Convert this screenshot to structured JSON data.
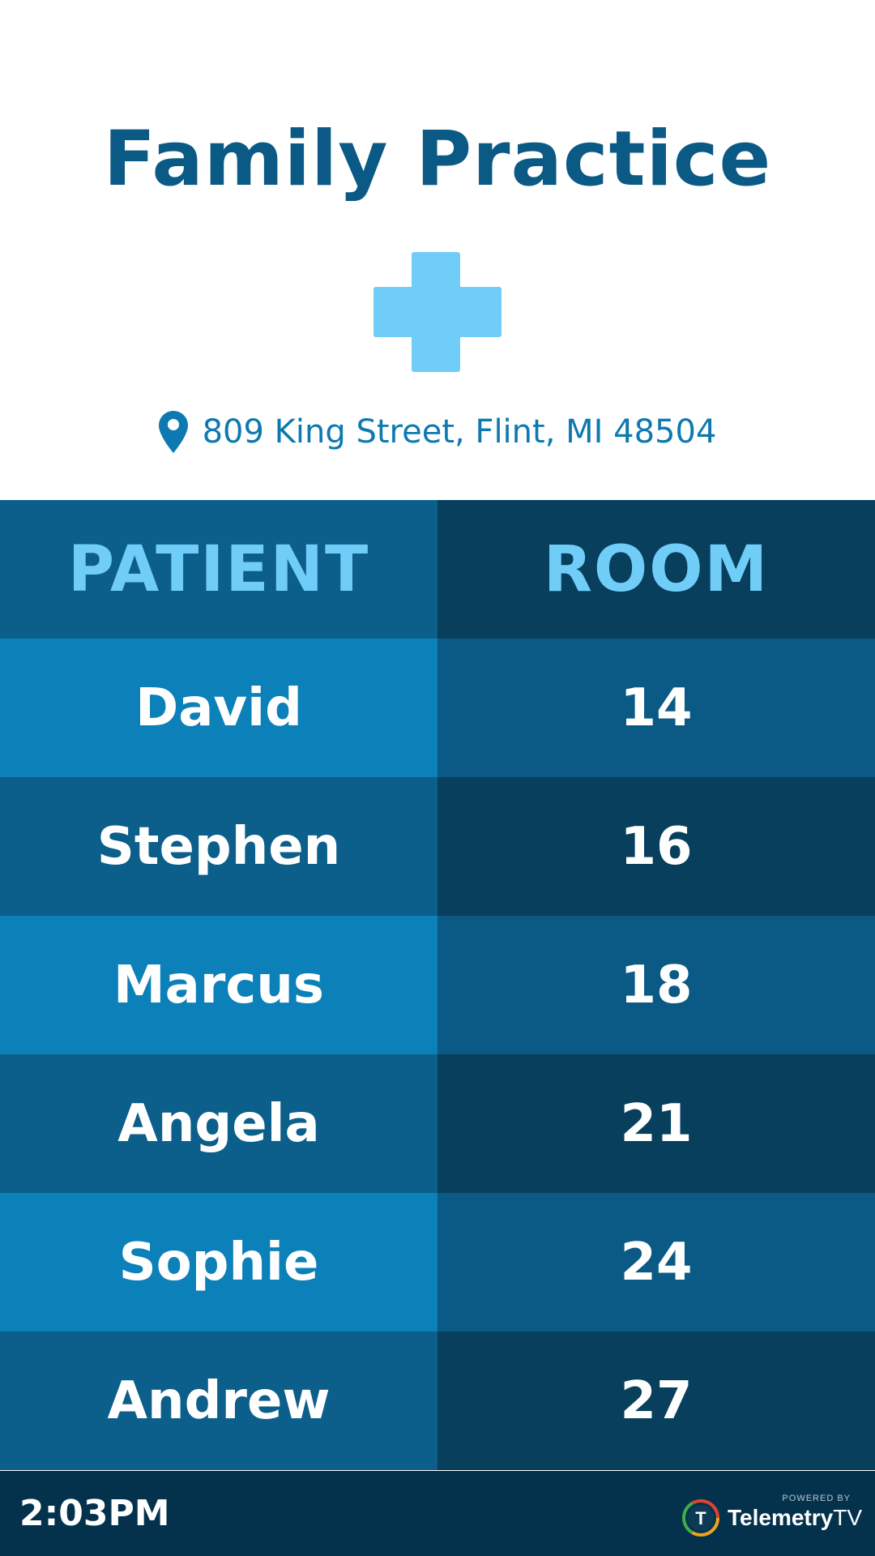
{
  "colors": {
    "title": "#0b5a85",
    "cross": "#70cdf8",
    "address": "#0e79b0",
    "header_cell_text": "#70cdf8",
    "patient_light": "#0c80b8",
    "patient_dark": "#0b5f8a",
    "room_light": "#0a5a85",
    "room_dark": "#073f5d",
    "footer": "#04324d"
  },
  "header": {
    "title": "Family Practice",
    "logo_icon": "medical-cross-icon",
    "address": {
      "icon": "map-pin-icon",
      "text": "809 King Street, Flint, MI 48504"
    }
  },
  "table": {
    "columns": [
      "PATIENT",
      "ROOM"
    ],
    "rows": [
      {
        "patient": "David",
        "room": "14"
      },
      {
        "patient": "Stephen",
        "room": "16"
      },
      {
        "patient": "Marcus",
        "room": "18"
      },
      {
        "patient": "Angela",
        "room": "21"
      },
      {
        "patient": "Sophie",
        "room": "24"
      },
      {
        "patient": "Andrew",
        "room": "27"
      }
    ]
  },
  "footer": {
    "time": "2:03PM",
    "brand": {
      "powered_by": "POWERED BY",
      "name": "Telemetry",
      "name_suffix": "TV",
      "logo_letter": "T"
    }
  }
}
